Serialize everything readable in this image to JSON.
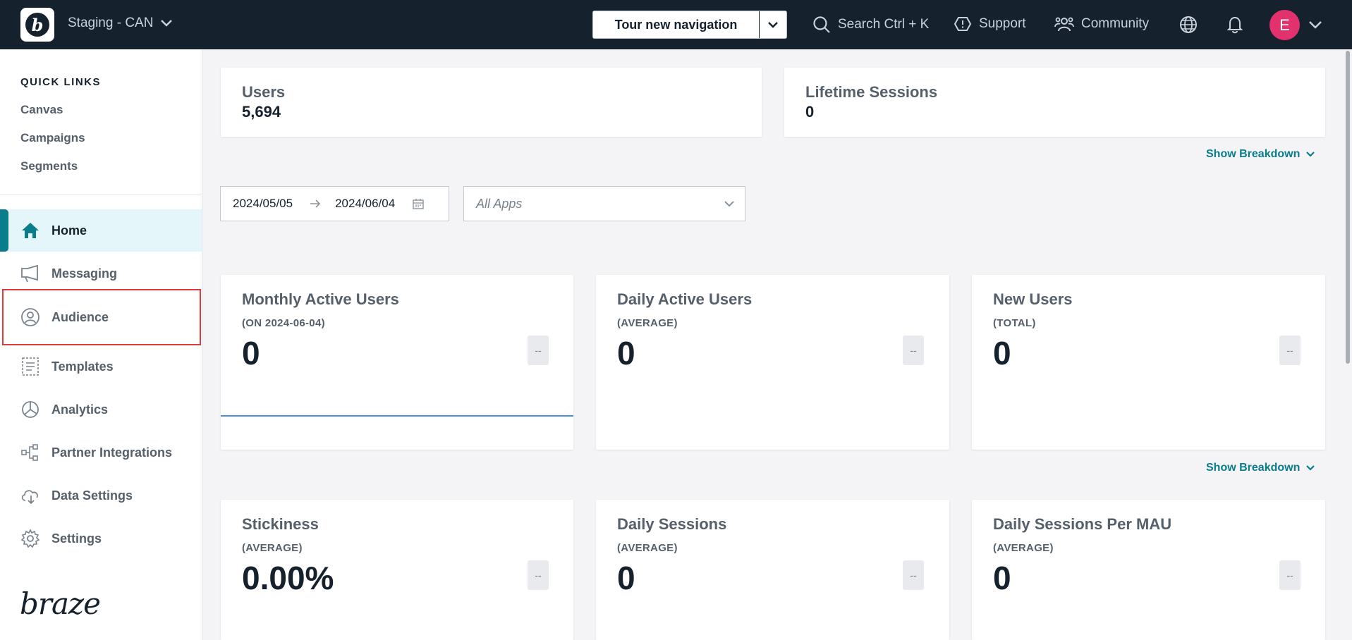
{
  "topbar": {
    "workspace": "Staging - CAN",
    "tour_button": "Tour new navigation",
    "search": "Search Ctrl + K",
    "support": "Support",
    "community": "Community",
    "avatar_initial": "E"
  },
  "sidebar": {
    "quick_links_title": "QUICK LINKS",
    "quick_links": [
      "Canvas",
      "Campaigns",
      "Segments"
    ],
    "items": [
      {
        "label": "Home",
        "icon": "home-icon"
      },
      {
        "label": "Messaging",
        "icon": "megaphone-icon"
      },
      {
        "label": "Audience",
        "icon": "user-circle-icon"
      },
      {
        "label": "Templates",
        "icon": "template-icon"
      },
      {
        "label": "Analytics",
        "icon": "pie-chart-icon"
      },
      {
        "label": "Partner Integrations",
        "icon": "integrations-icon"
      },
      {
        "label": "Data Settings",
        "icon": "cloud-icon"
      },
      {
        "label": "Settings",
        "icon": "gear-icon"
      }
    ],
    "brand": "braze"
  },
  "summary": {
    "users_label": "Users",
    "users_value": "5,694",
    "sessions_label": "Lifetime Sessions",
    "sessions_value": "0",
    "show_breakdown": "Show Breakdown"
  },
  "filters": {
    "start_date": "2024/05/05",
    "end_date": "2024/06/04",
    "apps_placeholder": "All Apps"
  },
  "metrics": [
    {
      "title": "Monthly Active Users",
      "sub": "(ON 2024-06-04)",
      "value": "0",
      "tag": "--"
    },
    {
      "title": "Daily Active Users",
      "sub": "(AVERAGE)",
      "value": "0",
      "tag": "--"
    },
    {
      "title": "New Users",
      "sub": "(TOTAL)",
      "value": "0",
      "tag": "--"
    },
    {
      "title": "Stickiness",
      "sub": "(AVERAGE)",
      "value": "0.00%",
      "tag": "--"
    },
    {
      "title": "Daily Sessions",
      "sub": "(AVERAGE)",
      "value": "0",
      "tag": "--"
    },
    {
      "title": "Daily Sessions Per MAU",
      "sub": "(AVERAGE)",
      "value": "0",
      "tag": "--"
    }
  ],
  "colors": {
    "topbar": "#16212e",
    "accent": "#0a7d8c",
    "avatar": "#e3316d",
    "highlight": "#e03a3a"
  }
}
